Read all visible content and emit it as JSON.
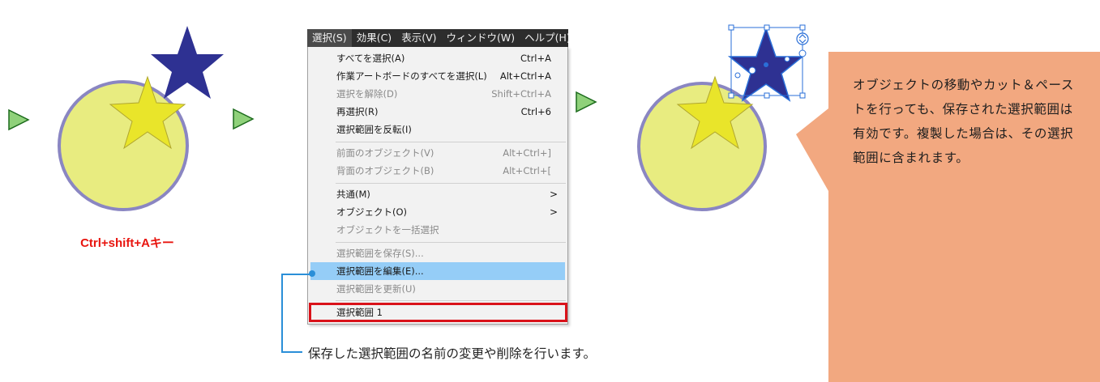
{
  "step1": {
    "shortcut_label": "Ctrl+shift+Aキー"
  },
  "menubar": {
    "items": [
      {
        "label": "選択(S)",
        "active": true
      },
      {
        "label": "効果(C)"
      },
      {
        "label": "表示(V)"
      },
      {
        "label": "ウィンドウ(W)"
      },
      {
        "label": "ヘルプ(H)"
      }
    ]
  },
  "menu": {
    "items": [
      {
        "label": "すべてを選択(A)",
        "shortcut": "Ctrl+A",
        "enabled": true
      },
      {
        "label": "作業アートボードのすべてを選択(L)",
        "shortcut": "Alt+Ctrl+A",
        "enabled": true
      },
      {
        "label": "選択を解除(D)",
        "shortcut": "Shift+Ctrl+A",
        "enabled": false
      },
      {
        "label": "再選択(R)",
        "shortcut": "Ctrl+6",
        "enabled": true
      },
      {
        "label": "選択範囲を反転(I)",
        "shortcut": "",
        "enabled": true
      },
      {
        "label": "前面のオブジェクト(V)",
        "shortcut": "Alt+Ctrl+]",
        "enabled": false
      },
      {
        "label": "背面のオブジェクト(B)",
        "shortcut": "Alt+Ctrl+[",
        "enabled": false
      },
      {
        "label": "共通(M)",
        "shortcut": ">",
        "enabled": true
      },
      {
        "label": "オブジェクト(O)",
        "shortcut": ">",
        "enabled": true
      },
      {
        "label": "オブジェクトを一括選択",
        "shortcut": "",
        "enabled": false
      },
      {
        "label": "選択範囲を保存(S)...",
        "shortcut": "",
        "enabled": false
      },
      {
        "label": "選択範囲を編集(E)...",
        "shortcut": "",
        "enabled": true
      },
      {
        "label": "選択範囲を更新(U)",
        "shortcut": "",
        "enabled": false
      },
      {
        "label": "選択範囲 1",
        "shortcut": "",
        "enabled": true
      }
    ]
  },
  "callout": {
    "text": "保存した選択範囲の名前の変更や削除を行います。"
  },
  "note": {
    "text": "オブジェクトの移動やカット＆ペーストを行っても、保存された選択範囲は有効です。複製した場合は、その選択範囲に含まれます。"
  },
  "colors": {
    "arrow_fill": "#8fd17a",
    "circle_fill": "#e8ec80",
    "circle_stroke": "#8a86c2",
    "star_yellow": "#e9e52a",
    "star_navy": "#2e3192",
    "selection_blue": "#2a6fd8",
    "note_bg": "#f2a880",
    "highlight": "#95cdf7",
    "red_box": "#d9121a"
  }
}
